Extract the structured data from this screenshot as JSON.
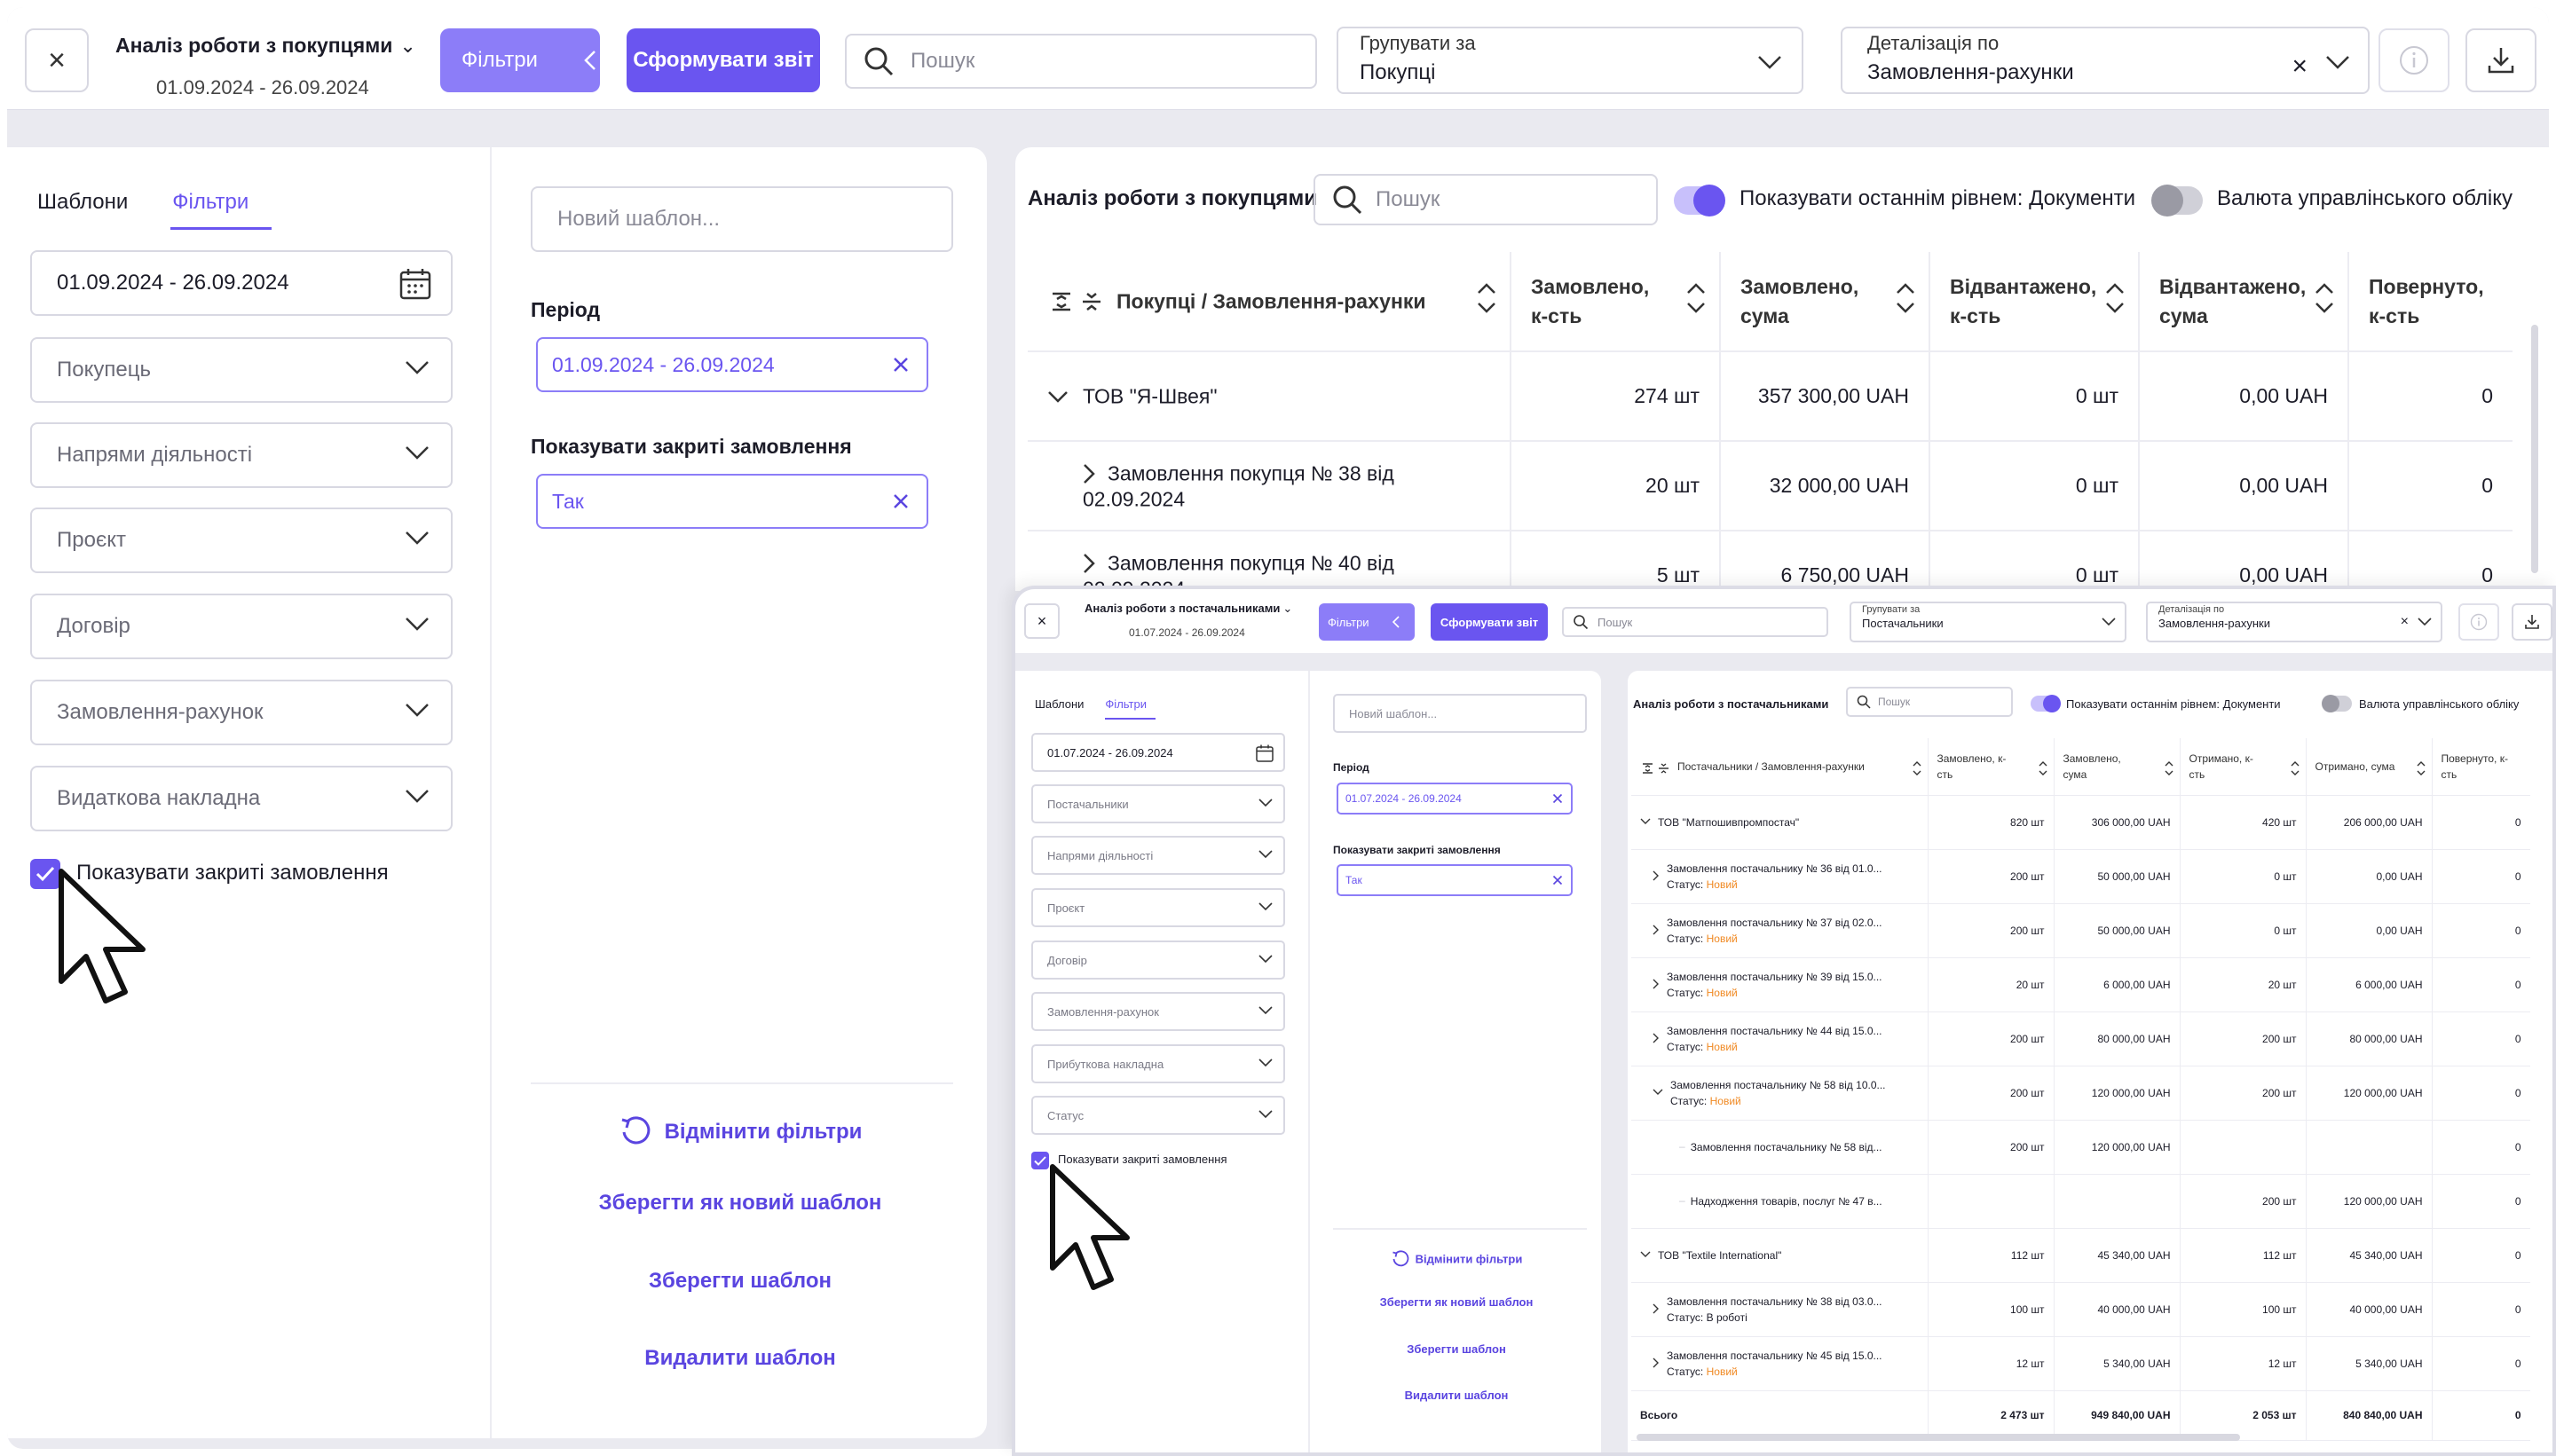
{
  "main": {
    "toolbar": {
      "close": "×",
      "title": "Аналіз роботи з покупцями",
      "date_range": "01.09.2024 - 26.09.2024",
      "filters_label": "Фільтри",
      "report_label": "Сформувати звіт",
      "search_placeholder": "Пошук",
      "group_label": "Групувати за",
      "group_value": "Покупці",
      "detail_label": "Деталізація по",
      "detail_value": "Замовлення-рахунки",
      "detail_clear": "×"
    },
    "left": {
      "tab_templates": "Шаблони",
      "tab_filters": "Фільтри",
      "period_field": "01.09.2024 - 26.09.2024",
      "fields": [
        "Покупець",
        "Напрями діяльності",
        "Проєкт",
        "Договір",
        "Замовлення-рахунок",
        "Видаткова накладна"
      ],
      "show_closed_label": "Показувати закриті замовлення",
      "template_placeholder": "Новий шаблон...",
      "period_heading": "Період",
      "period_chip": "01.09.2024 - 26.09.2024",
      "closed_heading": "Показувати закриті замовлення",
      "closed_chip": "Так",
      "cancel_filters": "Відмінити фільтри",
      "save_as_new": "Зберегти як новий шаблон",
      "save_template": "Зберегти шаблон",
      "delete_template": "Видалити шаблон"
    },
    "report": {
      "title": "Аналіз роботи з покупцями",
      "search_placeholder": "Пошук",
      "toggle_last_level": "Показувати останнім рівнем: Документи",
      "toggle_currency": "Валюта управлінського обліку",
      "columns": [
        "Покупці / Замовлення-рахунки",
        "Замовлено, к-сть",
        "Замовлено, сума",
        "Відвантажено, к-сть",
        "Відвантажено, сума",
        "Повернуто, к-сть"
      ],
      "rows": [
        {
          "name": "ТОВ \"Я-Швея\"",
          "c1": "274 шт",
          "c2": "357 300,00 UAH",
          "c3": "0 шт",
          "c4": "0,00 UAH",
          "c5": "0"
        },
        {
          "name": "Замовлення покупця № 38 від 02.09.2024",
          "c1": "20 шт",
          "c2": "32 000,00 UAH",
          "c3": "0 шт",
          "c4": "0,00 UAH",
          "c5": "0"
        },
        {
          "name": "Замовлення покупця № 40 від 02.09.2024",
          "c1": "5 шт",
          "c2": "6 750,00 UAH",
          "c3": "0 шт",
          "c4": "0,00 UAH",
          "c5": "0"
        }
      ]
    }
  },
  "inset": {
    "toolbar": {
      "close": "×",
      "title": "Аналіз роботи з постачальниками",
      "date_range": "01.07.2024 - 26.09.2024",
      "filters_label": "Фільтри",
      "report_label": "Сформувати звіт",
      "search_placeholder": "Пошук",
      "group_label": "Групувати за",
      "group_value": "Постачальники",
      "detail_label": "Деталізація по",
      "detail_value": "Замовлення-рахунки",
      "detail_clear": "×"
    },
    "left": {
      "tab_templates": "Шаблони",
      "tab_filters": "Фільтри",
      "period_field": "01.07.2024 - 26.09.2024",
      "fields": [
        "Постачальники",
        "Напрями діяльності",
        "Проєкт",
        "Договір",
        "Замовлення-рахунок",
        "Прибуткова накладна",
        "Статус"
      ],
      "show_closed_label": "Показувати закриті замовлення",
      "template_placeholder": "Новий шаблон...",
      "period_heading": "Період",
      "period_chip": "01.07.2024 - 26.09.2024",
      "closed_heading": "Показувати закриті замовлення",
      "closed_chip": "Так",
      "cancel_filters": "Відмінити фільтри",
      "save_as_new": "Зберегти як новий шаблон",
      "save_template": "Зберегти шаблон",
      "delete_template": "Видалити шаблон"
    },
    "report": {
      "title": "Аналіз роботи з постачальниками",
      "search_placeholder": "Пошук",
      "toggle_last_level": "Показувати останнім рівнем: Документи",
      "toggle_currency": "Валюта управлінського обліку",
      "columns": [
        "Постачальники / Замовлення-рахунки",
        "Замовлено, к-сть",
        "Замовлено, сума",
        "Отримано, к-сть",
        "Отримано, сума",
        "Повернуто, к-сть"
      ],
      "status_label": "Статус:",
      "rows": [
        {
          "level": 0,
          "exp": "down",
          "name": "ТОВ \"Матпошивпромпостач\"",
          "status": "",
          "c1": "820 шт",
          "c2": "306 000,00 UAH",
          "c3": "420 шт",
          "c4": "206 000,00 UAH",
          "c5": "0"
        },
        {
          "level": 1,
          "exp": "right",
          "name": "Замовлення постачальнику № 36 від 01.0...",
          "status": "Новий",
          "c1": "200 шт",
          "c2": "50 000,00 UAH",
          "c3": "0 шт",
          "c4": "0,00 UAH",
          "c5": "0"
        },
        {
          "level": 1,
          "exp": "right",
          "name": "Замовлення постачальнику № 37 від 02.0...",
          "status": "Новий",
          "c1": "200 шт",
          "c2": "50 000,00 UAH",
          "c3": "0 шт",
          "c4": "0,00 UAH",
          "c5": "0"
        },
        {
          "level": 1,
          "exp": "right",
          "name": "Замовлення постачальнику № 39 від 15.0...",
          "status": "Новий",
          "c1": "20 шт",
          "c2": "6 000,00 UAH",
          "c3": "20 шт",
          "c4": "6 000,00 UAH",
          "c5": "0"
        },
        {
          "level": 1,
          "exp": "right",
          "name": "Замовлення постачальнику № 44 від 15.0...",
          "status": "Новий",
          "c1": "200 шт",
          "c2": "80 000,00 UAH",
          "c3": "200 шт",
          "c4": "80 000,00 UAH",
          "c5": "0"
        },
        {
          "level": 1,
          "exp": "down",
          "name": "Замовлення постачальнику № 58 від 10.0...",
          "status": "Новий",
          "c1": "200 шт",
          "c2": "120 000,00 UAH",
          "c3": "200 шт",
          "c4": "120 000,00 UAH",
          "c5": "0"
        },
        {
          "level": 2,
          "exp": "",
          "name": "Замовлення постачальнику № 58 від...",
          "status": "",
          "c1": "200 шт",
          "c2": "120 000,00 UAH",
          "c3": "",
          "c4": "",
          "c5": "0"
        },
        {
          "level": 2,
          "exp": "",
          "name": "Надходження товарів, послуг № 47 в...",
          "status": "",
          "c1": "",
          "c2": "",
          "c3": "200 шт",
          "c4": "120 000,00 UAH",
          "c5": "0"
        },
        {
          "level": 0,
          "exp": "down",
          "name": "ТОВ \"Textile International\"",
          "status": "",
          "c1": "112 шт",
          "c2": "45 340,00 UAH",
          "c3": "112 шт",
          "c4": "45 340,00 UAH",
          "c5": "0"
        },
        {
          "level": 1,
          "exp": "right",
          "name": "Замовлення постачальнику № 38 від 03.0...",
          "status": "В роботі",
          "c1": "100 шт",
          "c2": "40 000,00 UAH",
          "c3": "100 шт",
          "c4": "40 000,00 UAH",
          "c5": "0"
        },
        {
          "level": 1,
          "exp": "right",
          "name": "Замовлення постачальнику № 45 від 15.0...",
          "status": "Новий",
          "c1": "12 шт",
          "c2": "5 340,00 UAH",
          "c3": "12 шт",
          "c4": "5 340,00 UAH",
          "c5": "0"
        }
      ],
      "total": {
        "name": "Всього",
        "c1": "2 473 шт",
        "c2": "949 840,00 UAH",
        "c3": "2 053 шт",
        "c4": "840 840,00 UAH",
        "c5": "0"
      }
    }
  },
  "colors": {
    "accent": "#6a55f0",
    "accent_light": "#8c7df8",
    "status_new": "#f08a24",
    "background": "#eaeaf0"
  }
}
